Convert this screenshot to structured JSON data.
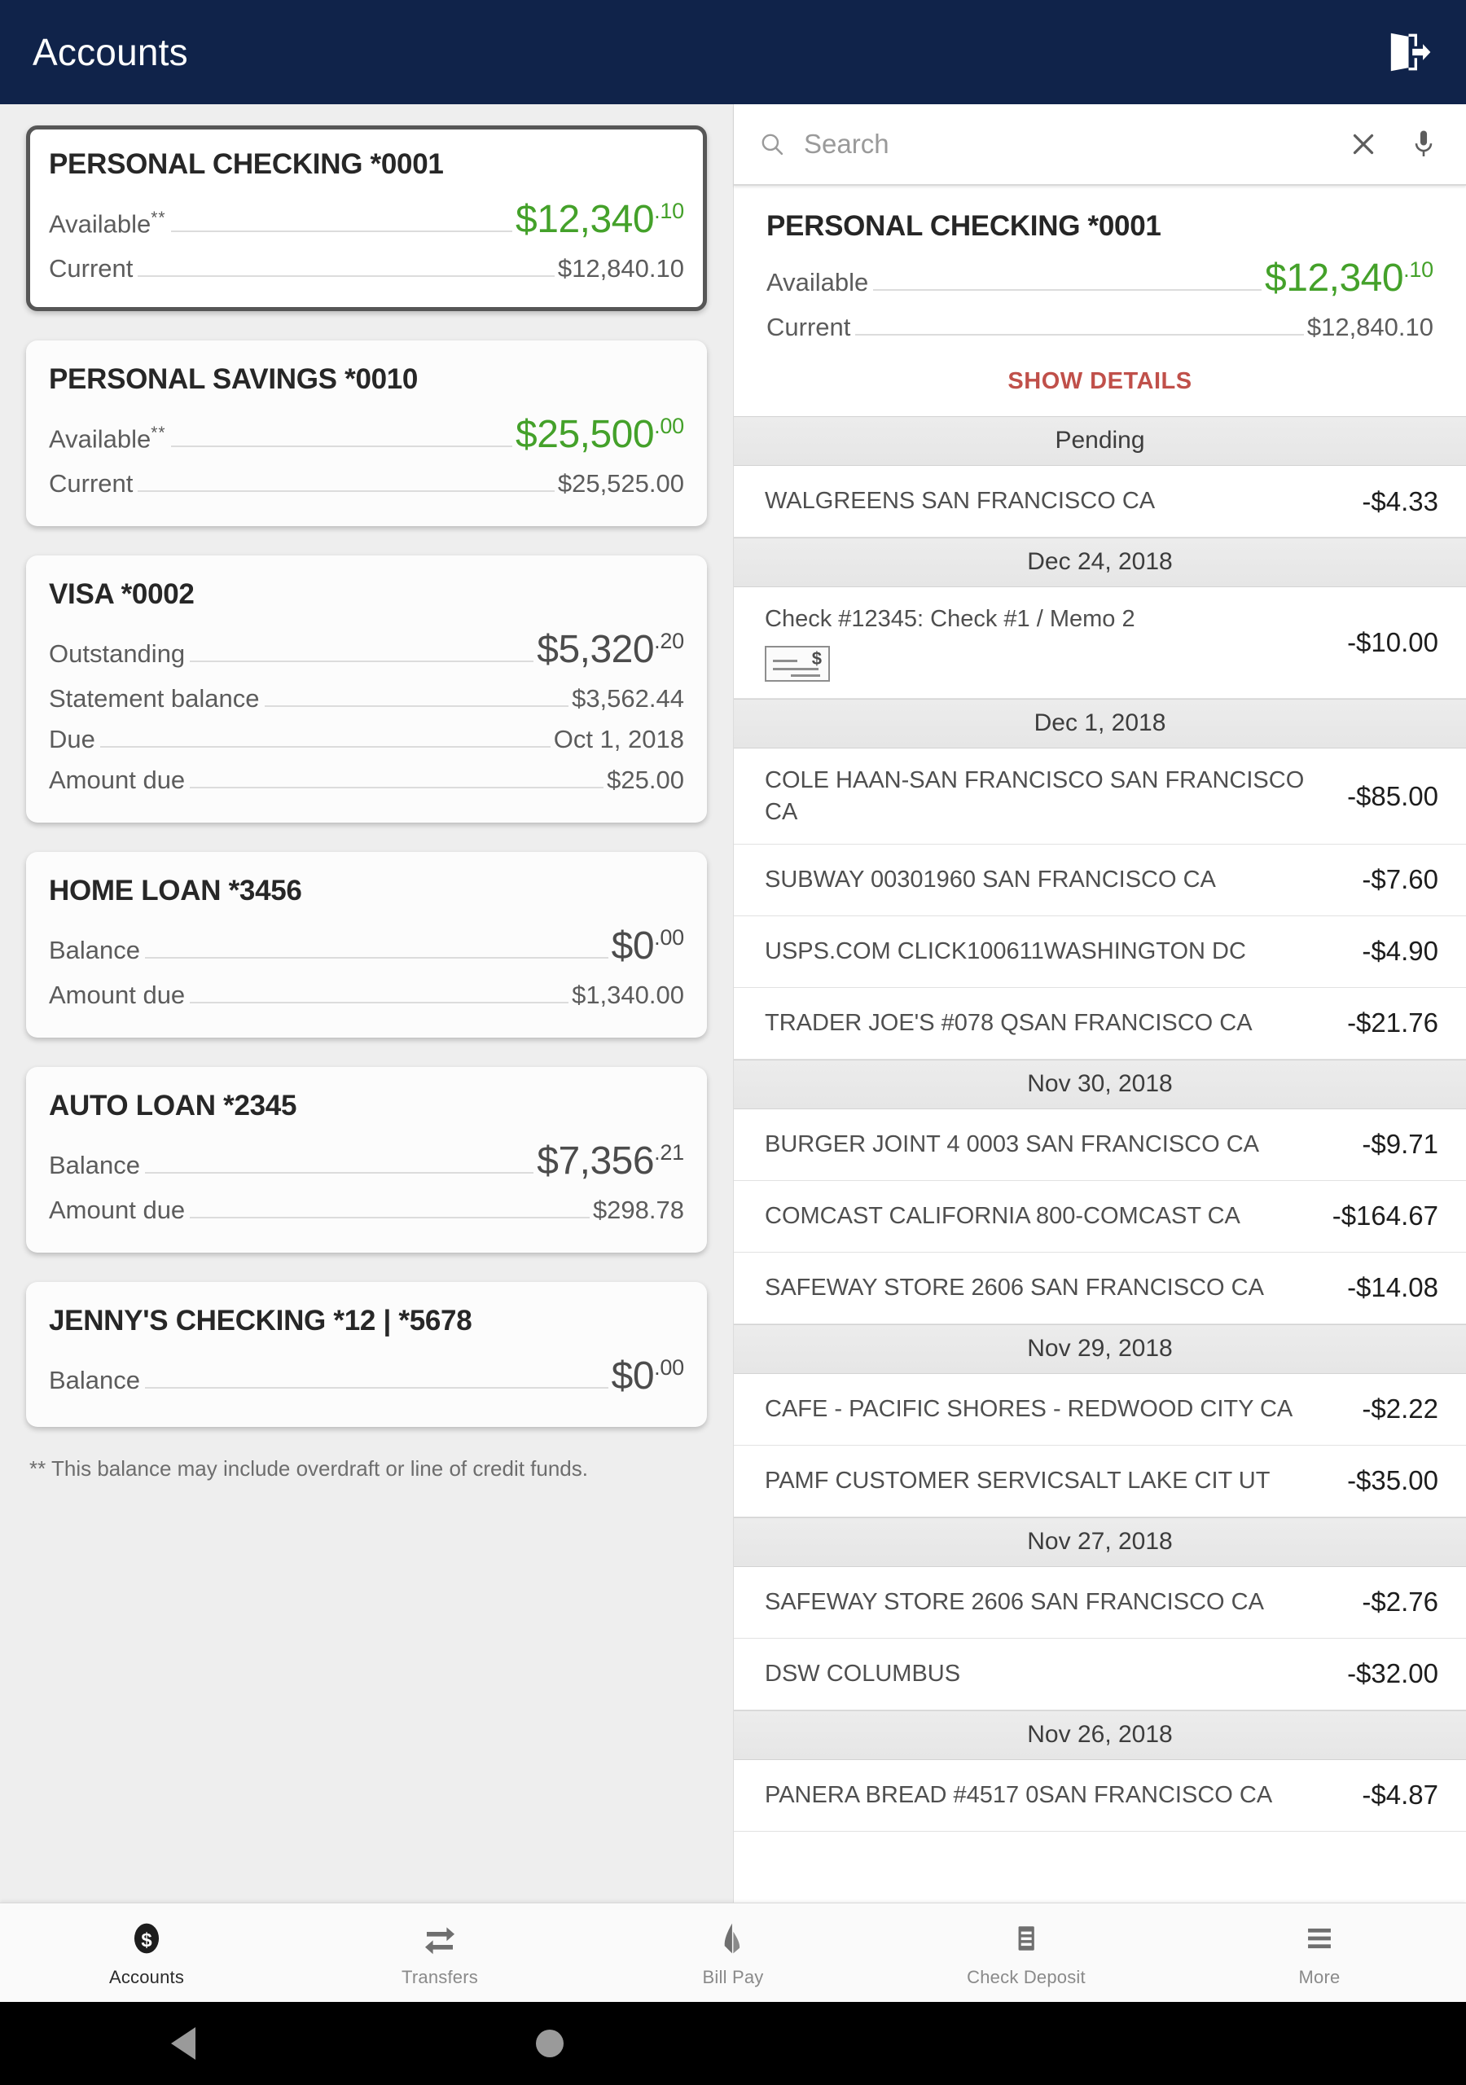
{
  "appbar": {
    "title": "Accounts",
    "logout_icon": "logout-icon"
  },
  "accounts": [
    {
      "title": "PERSONAL CHECKING *0001",
      "selected": true,
      "rows": [
        {
          "label": "Available",
          "asterisks": "**",
          "value_main": "$12,340",
          "value_cents": ".10",
          "big": true,
          "green": true
        },
        {
          "label": "Current",
          "asterisks": "",
          "value": "$12,840.10",
          "big": false,
          "green": false
        }
      ]
    },
    {
      "title": "PERSONAL SAVINGS *0010",
      "selected": false,
      "rows": [
        {
          "label": "Available",
          "asterisks": "**",
          "value_main": "$25,500",
          "value_cents": ".00",
          "big": true,
          "green": true
        },
        {
          "label": "Current",
          "asterisks": "",
          "value": "$25,525.00",
          "big": false,
          "green": false
        }
      ]
    },
    {
      "title": "VISA *0002",
      "selected": false,
      "rows": [
        {
          "label": "Outstanding",
          "asterisks": "",
          "value_main": "$5,320",
          "value_cents": ".20",
          "big": true,
          "green": false
        },
        {
          "label": "Statement balance",
          "asterisks": "",
          "value": "$3,562.44",
          "big": false,
          "green": false
        },
        {
          "label": "Due",
          "asterisks": "",
          "value": "Oct 1, 2018",
          "big": false,
          "green": false
        },
        {
          "label": "Amount due",
          "asterisks": "",
          "value": "$25.00",
          "big": false,
          "green": false
        }
      ]
    },
    {
      "title": "HOME LOAN *3456",
      "selected": false,
      "rows": [
        {
          "label": "Balance",
          "asterisks": "",
          "value_main": "$0",
          "value_cents": ".00",
          "big": true,
          "green": false
        },
        {
          "label": "Amount due",
          "asterisks": "",
          "value": "$1,340.00",
          "big": false,
          "green": false
        }
      ]
    },
    {
      "title": "AUTO LOAN *2345",
      "selected": false,
      "rows": [
        {
          "label": "Balance",
          "asterisks": "",
          "value_main": "$7,356",
          "value_cents": ".21",
          "big": true,
          "green": false
        },
        {
          "label": "Amount due",
          "asterisks": "",
          "value": "$298.78",
          "big": false,
          "green": false
        }
      ]
    },
    {
      "title": "JENNY'S CHECKING *12 | *5678",
      "selected": false,
      "rows": [
        {
          "label": "Balance",
          "asterisks": "",
          "value_main": "$0",
          "value_cents": ".00",
          "big": true,
          "green": false
        }
      ]
    }
  ],
  "footnote": "** This balance may include overdraft or line of credit funds.",
  "search": {
    "placeholder": "Search",
    "value": "",
    "search_icon": "search-icon",
    "clear_icon": "close-icon",
    "mic_icon": "microphone-icon"
  },
  "detail": {
    "title": "PERSONAL CHECKING *0001",
    "rows": [
      {
        "label": "Available",
        "value_main": "$12,340",
        "value_cents": ".10",
        "big": true,
        "green": true
      },
      {
        "label": "Current",
        "value": "$12,840.10",
        "big": false,
        "green": false
      }
    ],
    "show_details_label": "SHOW DETAILS",
    "accent_red": "#c0504a",
    "accent_green": "#44a12a"
  },
  "transactions": [
    {
      "date": "Pending",
      "items": [
        {
          "desc": "WALGREENS SAN FRANCISCO CA",
          "amount": "-$4.33",
          "has_check": false
        }
      ]
    },
    {
      "date": "Dec 24, 2018",
      "items": [
        {
          "desc": "Check #12345: Check #1 / Memo 2",
          "amount": "-$10.00",
          "has_check": true
        }
      ]
    },
    {
      "date": "Dec 1, 2018",
      "items": [
        {
          "desc": "COLE HAAN-SAN FRANCISCO SAN FRANCISCO CA",
          "amount": "-$85.00",
          "has_check": false
        },
        {
          "desc": "SUBWAY 00301960 SAN FRANCISCO CA",
          "amount": "-$7.60",
          "has_check": false
        },
        {
          "desc": "USPS.COM CLICK100611WASHINGTON DC",
          "amount": "-$4.90",
          "has_check": false
        },
        {
          "desc": "TRADER JOE'S #078 QSAN FRANCISCO CA",
          "amount": "-$21.76",
          "has_check": false
        }
      ]
    },
    {
      "date": "Nov 30, 2018",
      "items": [
        {
          "desc": "BURGER JOINT 4 0003 SAN FRANCISCO CA",
          "amount": "-$9.71",
          "has_check": false
        },
        {
          "desc": "COMCAST CALIFORNIA 800-COMCAST CA",
          "amount": "-$164.67",
          "has_check": false
        },
        {
          "desc": "SAFEWAY STORE 2606 SAN FRANCISCO CA",
          "amount": "-$14.08",
          "has_check": false
        }
      ]
    },
    {
      "date": "Nov 29, 2018",
      "items": [
        {
          "desc": "CAFE - PACIFIC SHORES - REDWOOD CITY CA",
          "amount": "-$2.22",
          "has_check": false
        },
        {
          "desc": "PAMF CUSTOMER SERVICSALT LAKE CIT UT",
          "amount": "-$35.00",
          "has_check": false
        }
      ]
    },
    {
      "date": "Nov 27, 2018",
      "items": [
        {
          "desc": "SAFEWAY STORE 2606 SAN FRANCISCO CA",
          "amount": "-$2.76",
          "has_check": false
        },
        {
          "desc": "DSW COLUMBUS",
          "amount": "-$32.00",
          "has_check": false
        }
      ]
    },
    {
      "date": "Nov 26, 2018",
      "items": [
        {
          "desc": "PANERA BREAD #4517 0SAN FRANCISCO CA",
          "amount": "-$4.87",
          "has_check": false
        }
      ]
    }
  ],
  "tabbar": [
    {
      "label": "Accounts",
      "icon": "dollar-coin-icon",
      "active": true
    },
    {
      "label": "Transfers",
      "icon": "transfer-arrows-icon",
      "active": false
    },
    {
      "label": "Bill Pay",
      "icon": "bill-pay-icon",
      "active": false
    },
    {
      "label": "Check Deposit",
      "icon": "check-deposit-icon",
      "active": false
    },
    {
      "label": "More",
      "icon": "hamburger-menu-icon",
      "active": false
    }
  ],
  "sysnav": {
    "back_icon": "android-back-icon",
    "home_icon": "android-home-icon"
  }
}
